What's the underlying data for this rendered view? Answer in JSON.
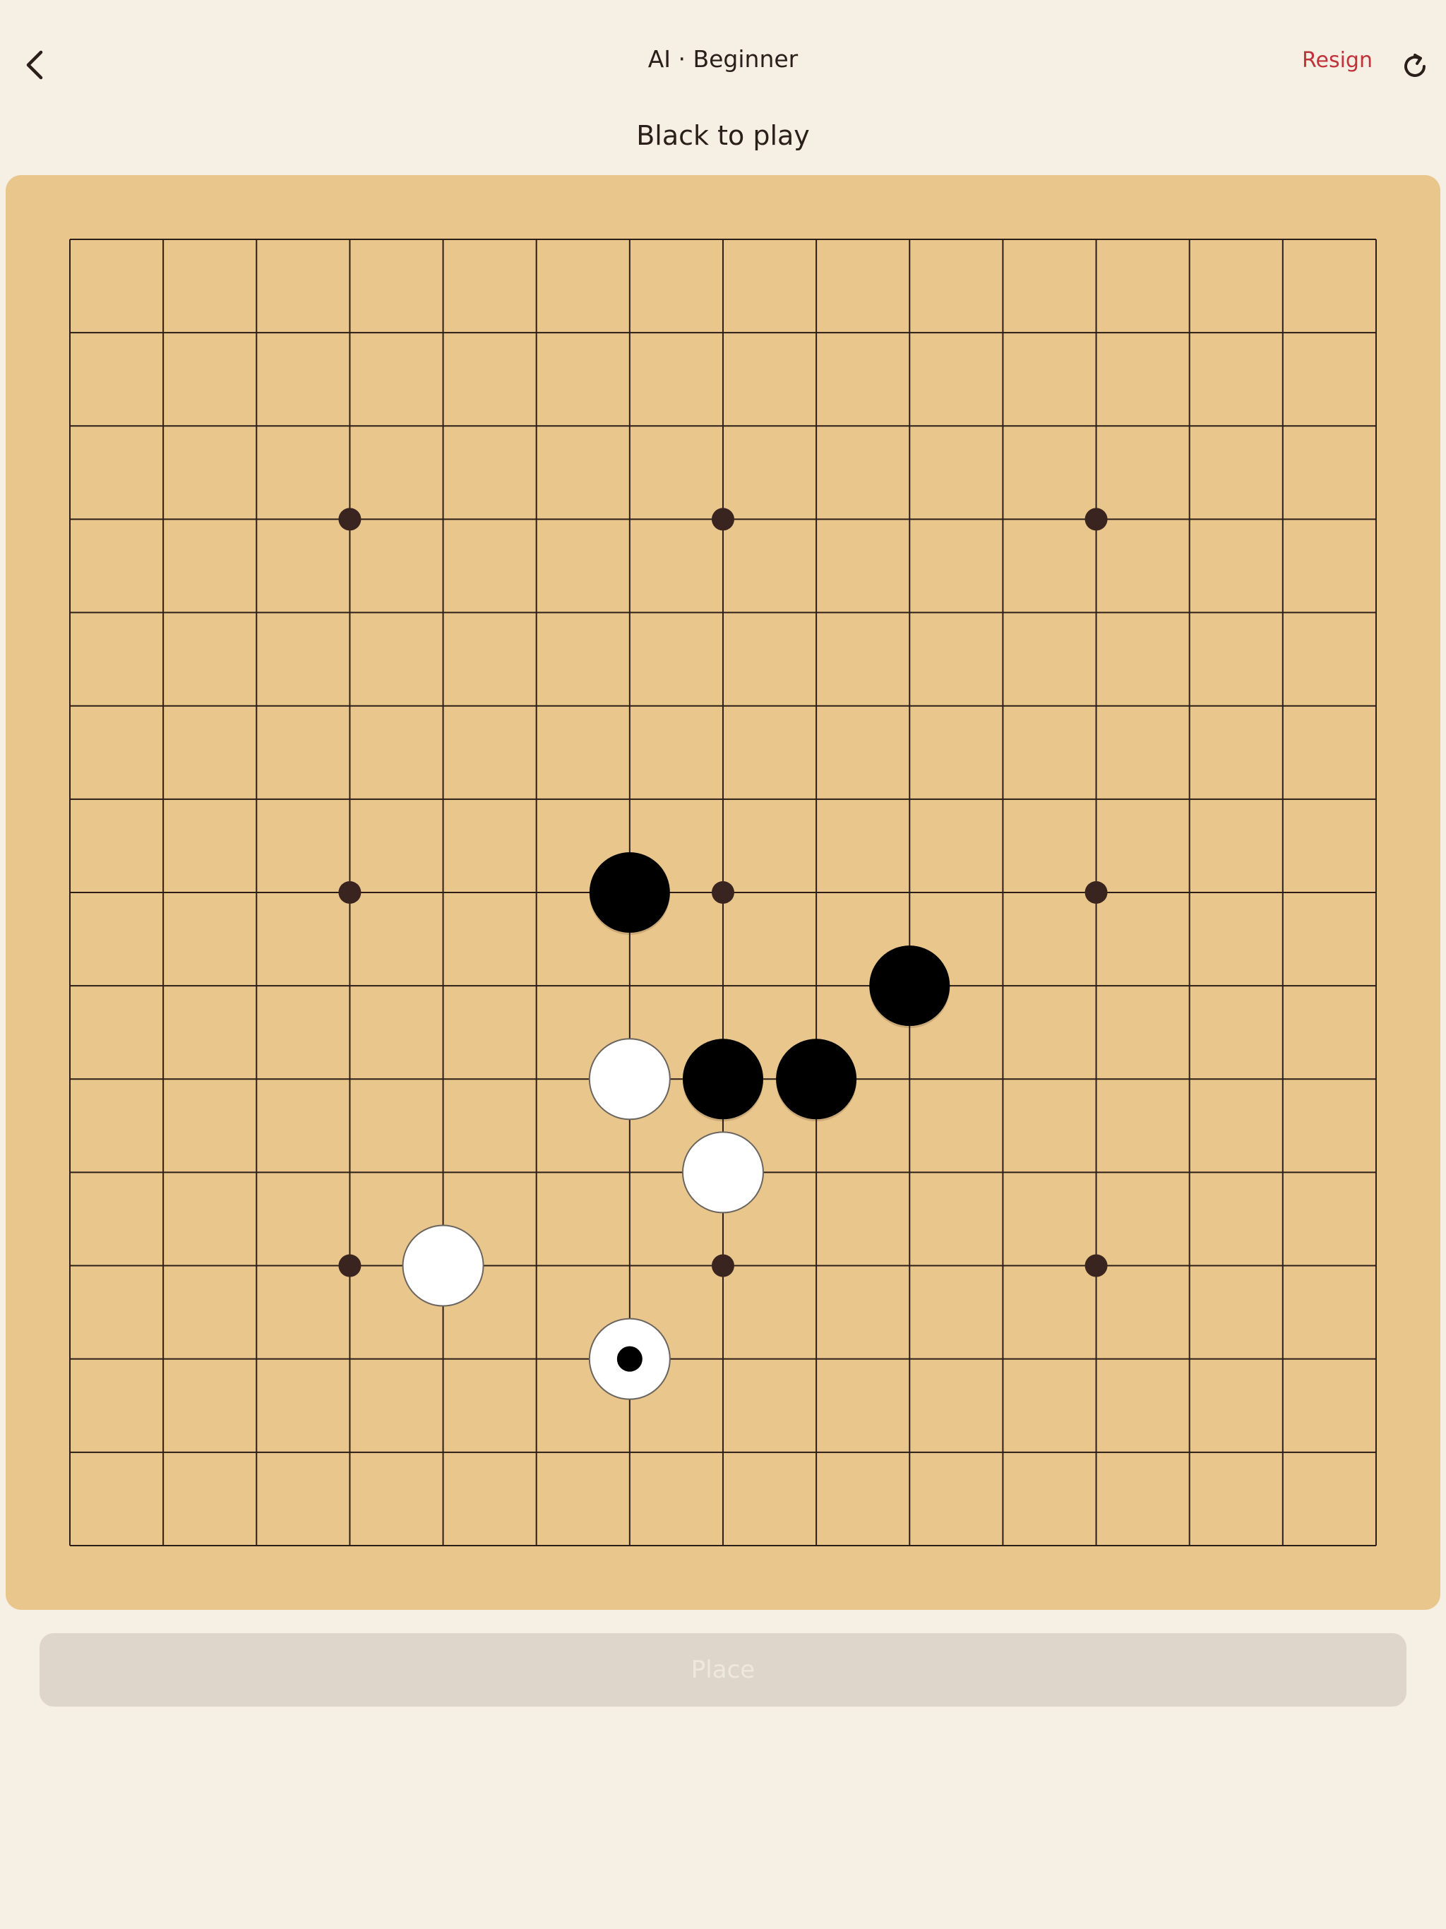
{
  "header": {
    "title": "AI · Beginner",
    "resign_label": "Resign"
  },
  "icons": {
    "back": "chevron-left-icon",
    "refresh": "refresh-icon"
  },
  "status": "Black to play",
  "colors": {
    "background": "#f6efe4",
    "board": "#e9c68c",
    "grid_line": "#2b1d17",
    "star_point": "#3a2420",
    "resign": "#c0333a",
    "place_button": "#ded6ca"
  },
  "board": {
    "size": 15,
    "star_points": [
      [
        3,
        3
      ],
      [
        7,
        3
      ],
      [
        11,
        3
      ],
      [
        3,
        7
      ],
      [
        7,
        7
      ],
      [
        11,
        7
      ],
      [
        3,
        11
      ],
      [
        7,
        11
      ],
      [
        11,
        11
      ]
    ],
    "stones": [
      {
        "col": 6,
        "row": 7,
        "color": "black"
      },
      {
        "col": 9,
        "row": 8,
        "color": "black"
      },
      {
        "col": 7,
        "row": 9,
        "color": "black"
      },
      {
        "col": 8,
        "row": 9,
        "color": "black"
      },
      {
        "col": 6,
        "row": 9,
        "color": "white"
      },
      {
        "col": 7,
        "row": 10,
        "color": "white"
      },
      {
        "col": 4,
        "row": 11,
        "color": "white"
      },
      {
        "col": 6,
        "row": 12,
        "color": "white",
        "last_move": true
      }
    ]
  },
  "actions": {
    "place_label": "Place"
  }
}
